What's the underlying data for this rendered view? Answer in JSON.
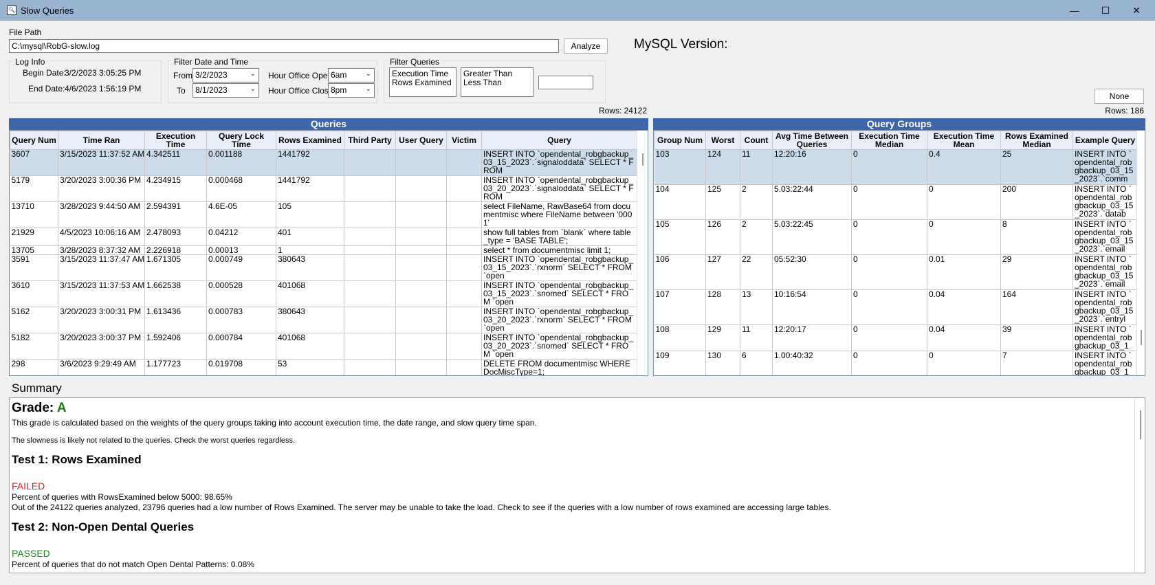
{
  "window": {
    "title": "Slow Queries",
    "minimize_icon": "minimize-icon",
    "maximize_icon": "maximize-icon",
    "close_icon": "close-icon"
  },
  "file": {
    "label": "File Path",
    "value": "C:\\mysql\\RobG-slow.log",
    "analyze_label": "Analyze"
  },
  "mysql_version_label": "MySQL Version:",
  "log_info": {
    "title": "Log Info",
    "begin_label": "Begin Date:",
    "begin_value": "3/2/2023 3:05:25 PM",
    "end_label": "End Date:",
    "end_value": "4/6/2023 1:56:19 PM"
  },
  "filter_date": {
    "title": "Filter Date and Time",
    "from_label": "From",
    "from_value": "3/2/2023",
    "to_label": "To",
    "to_value": "8/1/2023",
    "opens_label": "Hour Office Opens",
    "opens_value": "6am",
    "closes_label": "Hour Office Closes",
    "closes_value": "8pm"
  },
  "filter_queries": {
    "title": "Filter Queries",
    "fields": [
      "Execution Time",
      "Rows Examined"
    ],
    "comparators": [
      "Greater Than",
      "Less Than"
    ],
    "value": ""
  },
  "none_button": "None",
  "queries": {
    "title": "Queries",
    "rows_count": "Rows: 24122",
    "columns": [
      "Query Num",
      "Time Ran",
      "Execution Time",
      "Query Lock Time",
      "Rows Examined",
      "Third Party",
      "User Query",
      "Victim",
      "Query"
    ],
    "rows": [
      {
        "num": "3607",
        "time": "3/15/2023 11:37:52 AM",
        "exec": "4.342511",
        "lock": "0.001188",
        "rows": "1441792",
        "third": "",
        "user": "",
        "victim": "",
        "query": "INSERT INTO `opendental_robgbackup_03_15_2023`.`signaloddata` SELECT * FROM",
        "selected": true
      },
      {
        "num": "5179",
        "time": "3/20/2023 3:00:36 PM",
        "exec": "4.234915",
        "lock": "0.000468",
        "rows": "1441792",
        "third": "",
        "user": "",
        "victim": "",
        "query": "INSERT INTO `opendental_robgbackup_03_20_2023`.`signaloddata` SELECT * FROM"
      },
      {
        "num": "13710",
        "time": "3/28/2023 9:44:50 AM",
        "exec": "2.594391",
        "lock": "4.6E-05",
        "rows": "105",
        "third": "",
        "user": "",
        "victim": "",
        "query": "select FileName, RawBase64 from documentmisc where FileName between '0001'"
      },
      {
        "num": "21929",
        "time": "4/5/2023 10:06:16 AM",
        "exec": "2.478093",
        "lock": "0.04212",
        "rows": "401",
        "third": "",
        "user": "",
        "victim": "",
        "query": "show full tables from `blank` where table_type = 'BASE TABLE';"
      },
      {
        "num": "13705",
        "time": "3/28/2023 8:37:32 AM",
        "exec": "2.226918",
        "lock": "0.00013",
        "rows": "1",
        "third": "",
        "user": "",
        "victim": "",
        "query": "select * from documentmisc limit 1;"
      },
      {
        "num": "3591",
        "time": "3/15/2023 11:37:47 AM",
        "exec": "1.671305",
        "lock": "0.000749",
        "rows": "380643",
        "third": "",
        "user": "",
        "victim": "",
        "query": "INSERT INTO `opendental_robgbackup_03_15_2023`.`rxnorm` SELECT * FROM `open"
      },
      {
        "num": "3610",
        "time": "3/15/2023 11:37:53 AM",
        "exec": "1.662538",
        "lock": "0.000528",
        "rows": "401068",
        "third": "",
        "user": "",
        "victim": "",
        "query": "INSERT INTO `opendental_robgbackup_03_15_2023`.`snomed` SELECT * FROM `open"
      },
      {
        "num": "5162",
        "time": "3/20/2023 3:00:31 PM",
        "exec": "1.613436",
        "lock": "0.000783",
        "rows": "380643",
        "third": "",
        "user": "",
        "victim": "",
        "query": "INSERT INTO `opendental_robgbackup_03_20_2023`.`rxnorm` SELECT * FROM `open"
      },
      {
        "num": "5182",
        "time": "3/20/2023 3:00:37 PM",
        "exec": "1.592406",
        "lock": "0.000784",
        "rows": "401068",
        "third": "",
        "user": "",
        "victim": "",
        "query": "INSERT INTO `opendental_robgbackup_03_20_2023`.`snomed` SELECT * FROM `open"
      },
      {
        "num": "298",
        "time": "3/6/2023 9:29:49 AM",
        "exec": "1.177723",
        "lock": "0.019708",
        "rows": "53",
        "third": "",
        "user": "",
        "victim": "",
        "query": "DELETE FROM documentmisc WHERE DocMiscType=1;"
      }
    ]
  },
  "groups": {
    "title": "Query Groups",
    "rows_count": "Rows: 186",
    "columns": [
      "Group Num",
      "Worst",
      "Count",
      "Avg Time Between Queries",
      "Execution Time Median",
      "Execution Time Mean",
      "Rows Examined Median",
      "Example Query"
    ],
    "rows": [
      {
        "g": "103",
        "worst": "124",
        "count": "11",
        "avg": "12:20:16",
        "med": "0",
        "mean": "0.4",
        "rmed": "25",
        "ex": "INSERT INTO `opendental_robgbackup_03_15_2023`.`comm",
        "selected": true
      },
      {
        "g": "104",
        "worst": "125",
        "count": "2",
        "avg": "5.03:22:44",
        "med": "0",
        "mean": "0",
        "rmed": "200",
        "ex": "INSERT INTO `opendental_robgbackup_03_15_2023`.`datab"
      },
      {
        "g": "105",
        "worst": "126",
        "count": "2",
        "avg": "5.03:22:45",
        "med": "0",
        "mean": "0",
        "rmed": "8",
        "ex": "INSERT INTO `opendental_robgbackup_03_15_2023`.`email"
      },
      {
        "g": "106",
        "worst": "127",
        "count": "22",
        "avg": "05:52:30",
        "med": "0",
        "mean": "0.01",
        "rmed": "29",
        "ex": "INSERT INTO `opendental_robgbackup_03_15_2023`.`email"
      },
      {
        "g": "107",
        "worst": "128",
        "count": "13",
        "avg": "10:16:54",
        "med": "0",
        "mean": "0.04",
        "rmed": "164",
        "ex": "INSERT INTO `opendental_robgbackup_03_15_2023`.`entryl"
      },
      {
        "g": "108",
        "worst": "129",
        "count": "11",
        "avg": "12:20:17",
        "med": "0",
        "mean": "0.04",
        "rmed": "39",
        "ex": "INSERT INTO `opendental_robgbackup_03_1"
      },
      {
        "g": "109",
        "worst": "130",
        "count": "6",
        "avg": "1.00:40:32",
        "med": "0",
        "mean": "0",
        "rmed": "7",
        "ex": "INSERT INTO `opendental_robgbackup_03_1"
      }
    ]
  },
  "summary": {
    "label": "Summary",
    "grade_label": "Grade:",
    "grade": "A",
    "grade_desc": "This grade is calculated based on the weights of the query groups taking into account execution time, the date range, and slow query time span.",
    "slowness": "The slowness is likely not related to the queries. Check the worst queries regardless.",
    "test1_title": "Test 1: Rows Examined",
    "test1_status": "FAILED",
    "test1_line1": "Percent of queries with RowsExamined below 5000: 98.65%",
    "test1_line2": "Out of the 24122 queries analyzed, 23796 queries had a low number of Rows Examined. The server may be unable to take the load. Check to see if the queries with a low number of rows examined are accessing large tables.",
    "test2_title": "Test 2: Non-Open Dental Queries",
    "test2_status": "PASSED",
    "test2_line1": "Percent of queries that do not match Open Dental Patterns: 0.08%"
  }
}
